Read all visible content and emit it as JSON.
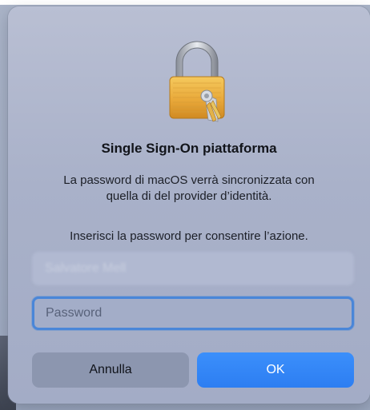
{
  "dialog": {
    "title": "Single Sign-On piattaforma",
    "message_line1": "La password di macOS verrà sincronizzata con",
    "message_line2": "quella di del provider d’identità.",
    "prompt": "Inserisci la password per consentire l’azione.",
    "icon": "lock-icon",
    "username_value": "Salvatore Mell",
    "password_placeholder": "Password",
    "cancel_label": "Annulla",
    "ok_label": "OK"
  },
  "colors": {
    "accent": "#3b8ffb",
    "focus_ring": "#4a86d8",
    "dialog_bg": "#aeb6cc"
  }
}
